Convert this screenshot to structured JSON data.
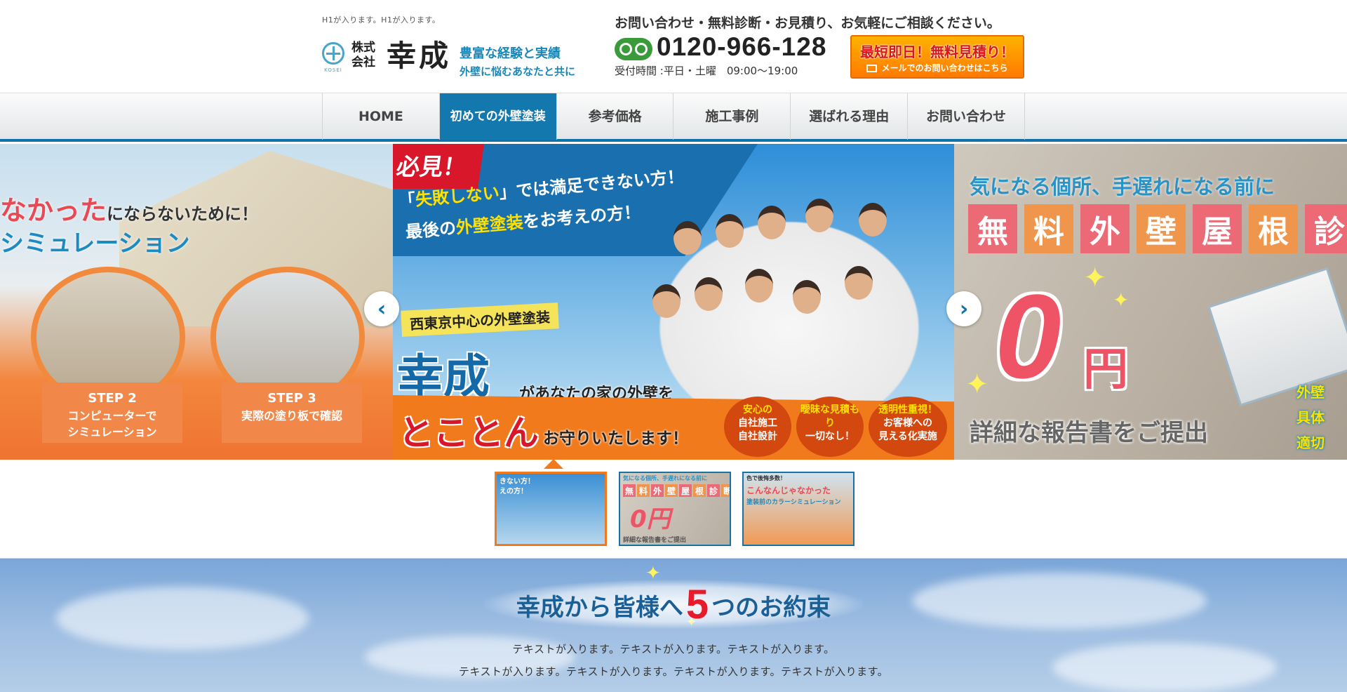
{
  "header": {
    "h1_text": "H1が入ります。H1が入ります。",
    "logo": {
      "corp_type": "株式会社",
      "name": "幸成",
      "mark_text": "KOSEI",
      "catch1": "豊富な経験と実績",
      "catch2": "外壁に悩むあなたと共に"
    },
    "contact_lead": "お問い合わせ・無料診断・お見積り、お気軽にご相談ください。",
    "phone": "0120-966-128",
    "hours": "受付時間 :平日・土曜　09:00〜19:00",
    "estimate_button": {
      "main": "最短即日！無料見積り！",
      "sub": "メールでのお問い合わせはこちら"
    }
  },
  "nav": {
    "items": [
      {
        "label": "HOME"
      },
      {
        "label": "初めての外壁塗装"
      },
      {
        "label": "参考価格"
      },
      {
        "label": "施工事例"
      },
      {
        "label": "選ばれる理由"
      },
      {
        "label": "お問い合わせ"
      }
    ],
    "active_index": 1
  },
  "slider": {
    "left": {
      "text1": "なかった",
      "text1_small": "にならないために！",
      "text2": "シミュレーション",
      "steps": [
        {
          "num": "STEP 2",
          "desc1": "コンピューターで",
          "desc2": "シミュレーション"
        },
        {
          "num": "STEP 3",
          "desc1": "実際の塗り板で確認",
          "desc2": ""
        }
      ]
    },
    "main": {
      "hikken": "必見！",
      "line1_a": "「",
      "line1_b": "失敗しない",
      "line1_c": "」では満足できない方！",
      "line2_a": "最後の",
      "line2_b": "外壁塗装",
      "line2_c": "をお考えの方！",
      "area": "西東京中心の外壁塗装",
      "company": "幸成",
      "company_after": "があなたの家の外壁を",
      "tokoton": "とことん",
      "tokoton_after": "お守りいたします！",
      "badges": [
        {
          "l1": "安心の",
          "l2": "自社施工",
          "l3": "自社設計"
        },
        {
          "l1": "曖昧な見積もり",
          "l2": "一切なし！",
          "l3": ""
        },
        {
          "l1": "透明性重視！",
          "l2": "お客様への",
          "l3": "見える化実施"
        }
      ]
    },
    "right": {
      "lead": "気になる個所、手遅れになる前に",
      "tiles": [
        "無",
        "料",
        "外",
        "壁",
        "屋",
        "根",
        "診"
      ],
      "zero": "0",
      "yen": "円",
      "report": "詳細な報告書をご提出",
      "checks": [
        "外壁",
        "具体",
        "適切"
      ]
    },
    "prev_arrow": "‹",
    "next_arrow": "›"
  },
  "thumbs": [
    {
      "text": "きない方！",
      "text2": "えの方！"
    },
    {
      "text": "気になる個所、手遅れになる前に",
      "tiles": [
        "無",
        "料",
        "外",
        "壁",
        "屋",
        "根",
        "診",
        "断"
      ],
      "zero": "0円",
      "report": "詳細な報告書をご提出"
    },
    {
      "text": "色で後悔多数！",
      "text2": "こんなんじゃなかった",
      "text3": "塗装前のカラーシミュレーション"
    }
  ],
  "promise": {
    "title_a": "幸成から皆様へ",
    "title_num": "5",
    "title_b": "つのお約束",
    "text1": "テキストが入ります。テキストが入ります。テキストが入ります。",
    "text2": "テキストが入ります。テキストが入ります。テキストが入ります。テキストが入ります。"
  },
  "colors": {
    "brand_blue": "#1378ad",
    "accent_orange": "#f07a1c",
    "accent_red": "#d8172b"
  }
}
